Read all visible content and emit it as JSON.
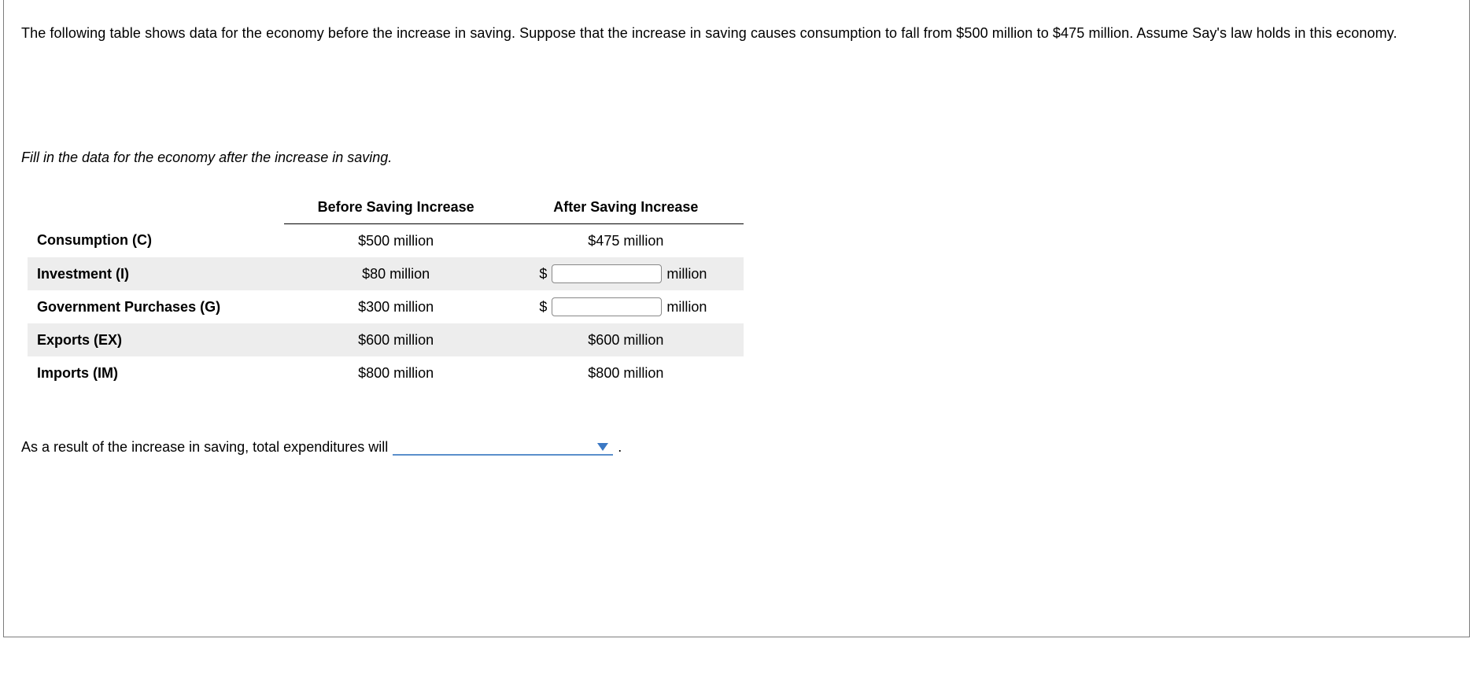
{
  "intro_text": "The following table shows data for the economy before the increase in saving. Suppose that the increase in saving causes consumption to fall from $500 million to $475 million. Assume Say's law holds in this economy.",
  "prompt_text": "Fill in the data for the economy after the increase in saving.",
  "table": {
    "headers": {
      "blank": "",
      "before": "Before Saving Increase",
      "after": "After Saving Increase"
    },
    "rows": [
      {
        "label": "Consumption (C)",
        "before": "$500 million",
        "after_type": "text",
        "after": "$475 million"
      },
      {
        "label": "Investment (I)",
        "before": "$80 million",
        "after_type": "input",
        "currency": "$",
        "value": "",
        "unit": "million"
      },
      {
        "label": "Government Purchases (G)",
        "before": "$300 million",
        "after_type": "input",
        "currency": "$",
        "value": "",
        "unit": "million"
      },
      {
        "label": "Exports (EX)",
        "before": "$600 million",
        "after_type": "text",
        "after": "$600 million"
      },
      {
        "label": "Imports (IM)",
        "before": "$800 million",
        "after_type": "text",
        "after": "$800 million"
      }
    ]
  },
  "closing": {
    "lead": "As a result of the increase in saving, total expenditures will",
    "dropdown_value": "",
    "period": "."
  }
}
